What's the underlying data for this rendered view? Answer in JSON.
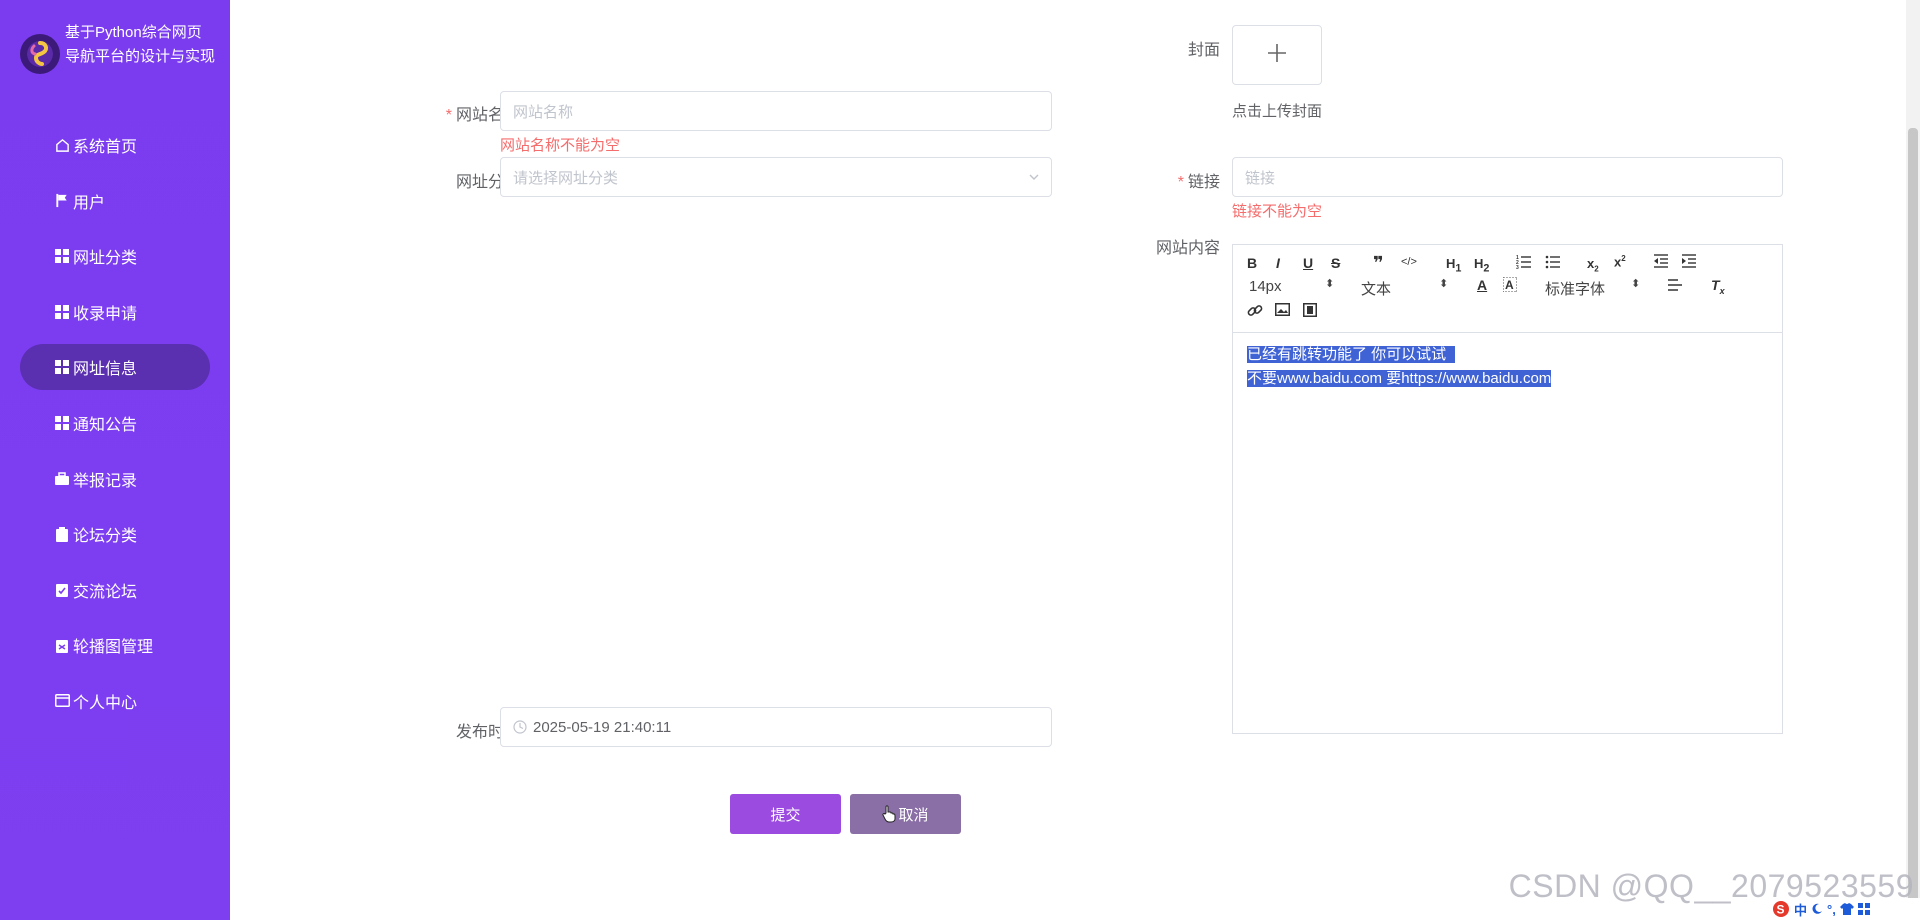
{
  "sidebar": {
    "title": "基于Python综合网页导航平台的设计与实现",
    "items": [
      {
        "label": "系统首页",
        "icon": "home-icon"
      },
      {
        "label": "用户",
        "icon": "flag-icon"
      },
      {
        "label": "网址分类",
        "icon": "grid-icon"
      },
      {
        "label": "收录申请",
        "icon": "grid-icon"
      },
      {
        "label": "网址信息",
        "icon": "grid-icon",
        "active": true
      },
      {
        "label": "通知公告",
        "icon": "grid-icon"
      },
      {
        "label": "举报记录",
        "icon": "briefcase-icon"
      },
      {
        "label": "论坛分类",
        "icon": "clipboard-icon"
      },
      {
        "label": "交流论坛",
        "icon": "clipboard-check-icon"
      },
      {
        "label": "轮播图管理",
        "icon": "clipboard-list-icon"
      },
      {
        "label": "个人中心",
        "icon": "card-icon"
      }
    ]
  },
  "form": {
    "site_name": {
      "label": "网站名称",
      "placeholder": "网站名称",
      "error": "网站名称不能为空"
    },
    "category": {
      "label": "网址分类",
      "placeholder": "请选择网址分类"
    },
    "cover": {
      "label": "封面",
      "hint": "点击上传封面"
    },
    "link": {
      "label": "链接",
      "placeholder": "链接",
      "error": "链接不能为空"
    },
    "content": {
      "label": "网站内容",
      "toolbar": {
        "font_size": "14px",
        "text_style": "文本",
        "font_family": "标准字体"
      },
      "lines": [
        "已经有跳转功能了 你可以试试",
        "不要www.baidu.com 要https://www.baidu.com"
      ]
    },
    "publish_time": {
      "label": "发布时间",
      "value": "2025-05-19 21:40:11"
    },
    "submit_label": "提交",
    "cancel_label": "取消"
  },
  "watermark": "CSDN @QQ__2079523559",
  "ime": {
    "label": "中"
  },
  "colors": {
    "sidebar": "#7b3cf0",
    "active": "#5a2fb0",
    "submit": "#9b4be0",
    "cancel": "#8a6fa6",
    "error": "#f56c6c",
    "selection": "#3f62d4"
  }
}
